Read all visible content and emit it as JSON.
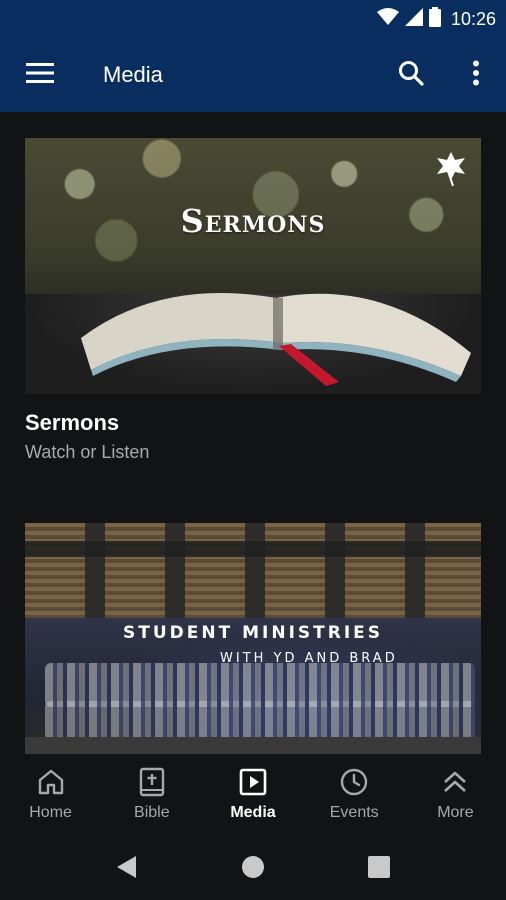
{
  "status_bar": {
    "time": "10:26",
    "icons": [
      "wifi-icon",
      "signal-icon",
      "battery-icon"
    ]
  },
  "app_bar": {
    "title": "Media",
    "menu_icon": "hamburger-menu-icon",
    "search_icon": "search-icon",
    "overflow_icon": "more-vert-icon",
    "background": "#0a2d60"
  },
  "cards": [
    {
      "thumbnail_text": "Sermons",
      "title": "Sermons",
      "subtitle": "Watch or Listen"
    },
    {
      "thumbnail_text": "STUDENT MINISTRIES",
      "thumbnail_subtext": "WITH YD AND BRAD"
    }
  ],
  "bottom_nav": {
    "items": [
      {
        "label": "Home",
        "icon": "home-icon",
        "active": false
      },
      {
        "label": "Bible",
        "icon": "bible-icon",
        "active": false
      },
      {
        "label": "Media",
        "icon": "media-play-icon",
        "active": true
      },
      {
        "label": "Events",
        "icon": "clock-icon",
        "active": false
      },
      {
        "label": "More",
        "icon": "chevrons-up-icon",
        "active": false
      }
    ]
  },
  "system_nav": {
    "icons": [
      "back-icon",
      "home-circle-icon",
      "recents-icon"
    ]
  },
  "colors": {
    "background": "#121315",
    "primary": "#0a2d60",
    "text_secondary": "#a9aaac",
    "nav_inactive": "#a7a8aa"
  }
}
